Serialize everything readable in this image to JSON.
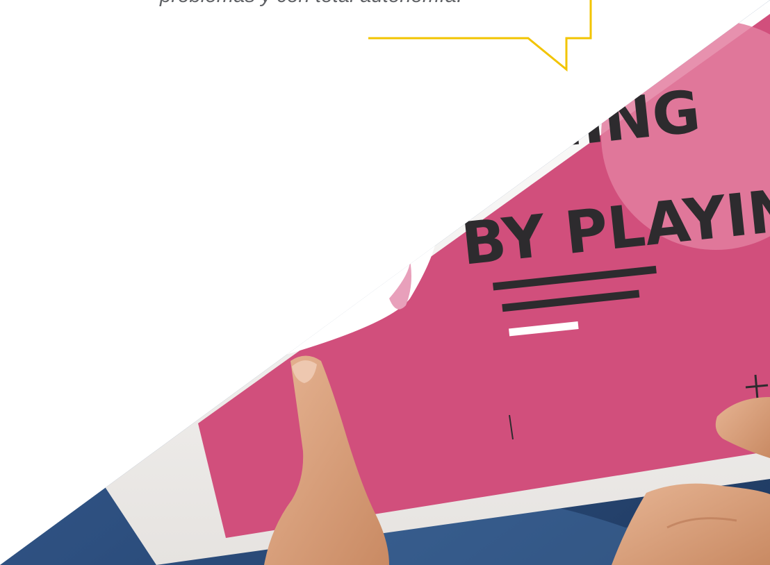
{
  "quote": {
    "text": "problemas y con total autonomía."
  },
  "tablet_screen": {
    "line1": "NING",
    "line2": "BY PLAYING"
  },
  "colors": {
    "callout_border": "#f2c400",
    "quote_text": "#5f6165",
    "screen_pink": "#d14f7c",
    "screen_pink_light": "#e37ea0",
    "headline_dark": "#2d2b2e",
    "jeans_blue": "#2d4f7f",
    "skin": "#d9a07a",
    "tablet_frame": "#f4f2f0"
  }
}
